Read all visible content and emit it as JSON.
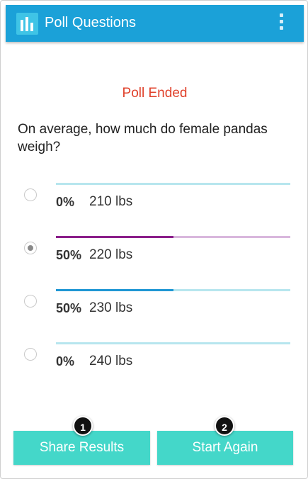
{
  "app": {
    "title": "Poll Questions",
    "icon": "bar-chart-icon",
    "menu_icon": "overflow-menu-icon",
    "color": "#1ba1d8"
  },
  "poll": {
    "status": "Poll Ended",
    "question": "On average, how much do female pandas weigh?",
    "options": [
      {
        "percent_label": "0%",
        "label": "210 lbs",
        "fraction": 0.0,
        "selected": false,
        "fill_color": "#1ba1d8",
        "track_color": "#b7e6ee"
      },
      {
        "percent_label": "50%",
        "label": "220 lbs",
        "fraction": 0.5,
        "selected": true,
        "fill_color": "#8b1f8a",
        "track_color": "#d9b7dd"
      },
      {
        "percent_label": "50%",
        "label": "230 lbs",
        "fraction": 0.5,
        "selected": false,
        "fill_color": "#1f97d4",
        "track_color": "#b7e6ee"
      },
      {
        "percent_label": "0%",
        "label": "240 lbs",
        "fraction": 0.0,
        "selected": false,
        "fill_color": "#1ba1d8",
        "track_color": "#b7e6ee"
      }
    ]
  },
  "actions": {
    "share_label": "Share Results",
    "restart_label": "Start Again",
    "share_badge": "1",
    "restart_badge": "2",
    "button_color": "#44d7c9"
  }
}
